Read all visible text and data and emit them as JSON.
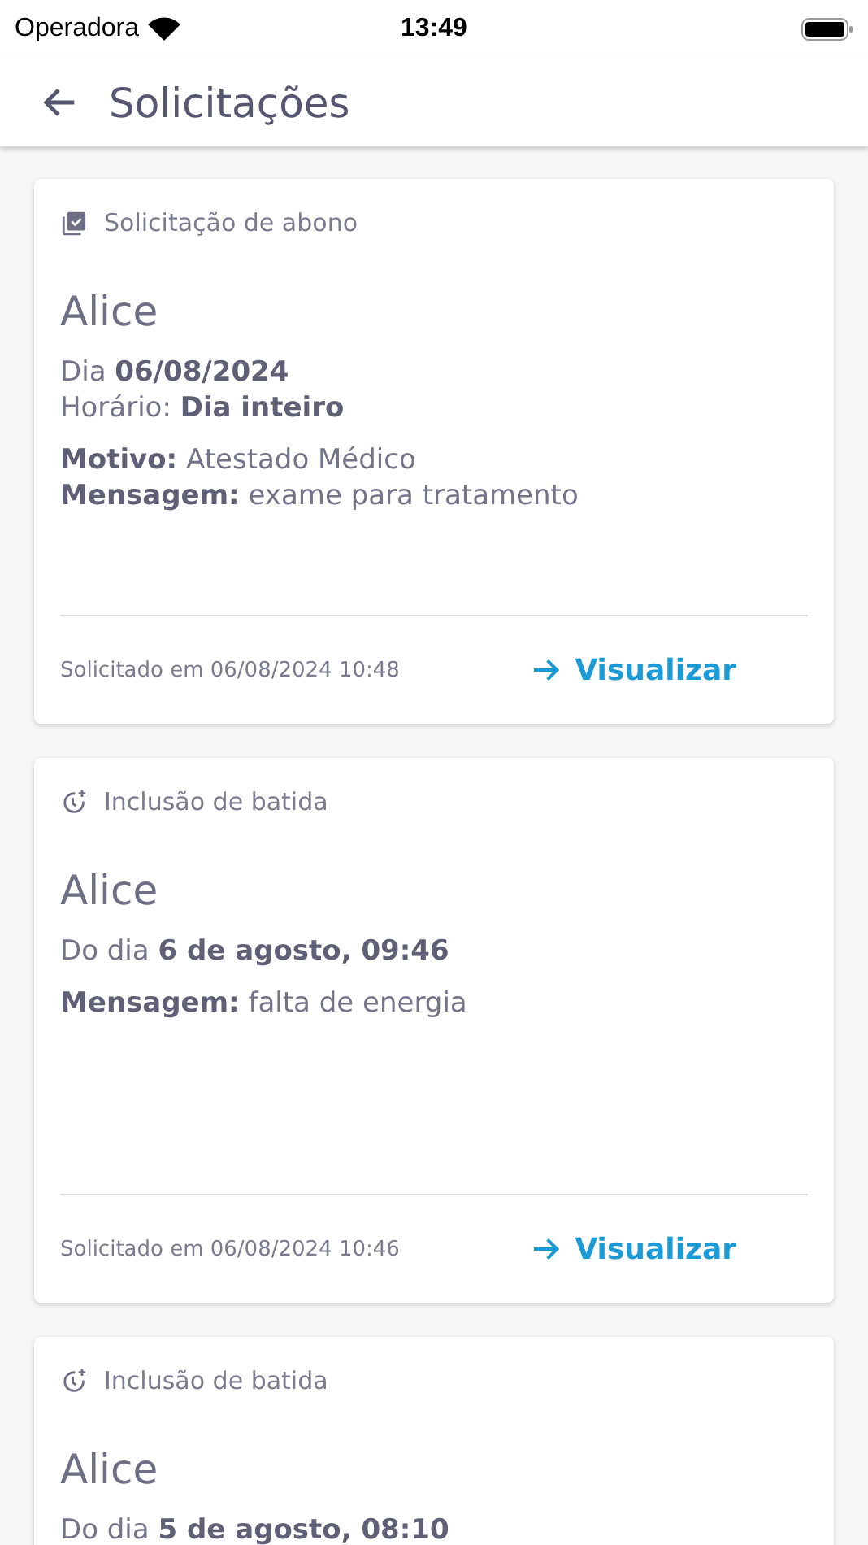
{
  "status_bar": {
    "carrier": "Operadora",
    "time": "13:49"
  },
  "app_bar": {
    "title": "Solicitações"
  },
  "cards": [
    {
      "kind": "abono",
      "type_label": "Solicitação de abono",
      "name": "Alice",
      "groups": [
        [
          "Dia **06/08/2024**",
          "Horário: **Dia inteiro**"
        ],
        [
          "**Motivo:** Atestado Médico",
          "**Mensagem:** exame para tratamento"
        ]
      ],
      "requested": "Solicitado em 06/08/2024 10:48",
      "action": "Visualizar"
    },
    {
      "kind": "batida",
      "type_label": "Inclusão de batida",
      "name": "Alice",
      "groups": [
        [
          "Do dia **6 de agosto, 09:46**"
        ],
        [
          "**Mensagem:** falta de energia"
        ]
      ],
      "requested": "Solicitado em 06/08/2024 10:46",
      "action": "Visualizar"
    },
    {
      "kind": "batida",
      "type_label": "Inclusão de batida",
      "name": "Alice",
      "groups": [
        [
          "Do dia **5 de agosto, 08:10**"
        ]
      ]
    }
  ]
}
